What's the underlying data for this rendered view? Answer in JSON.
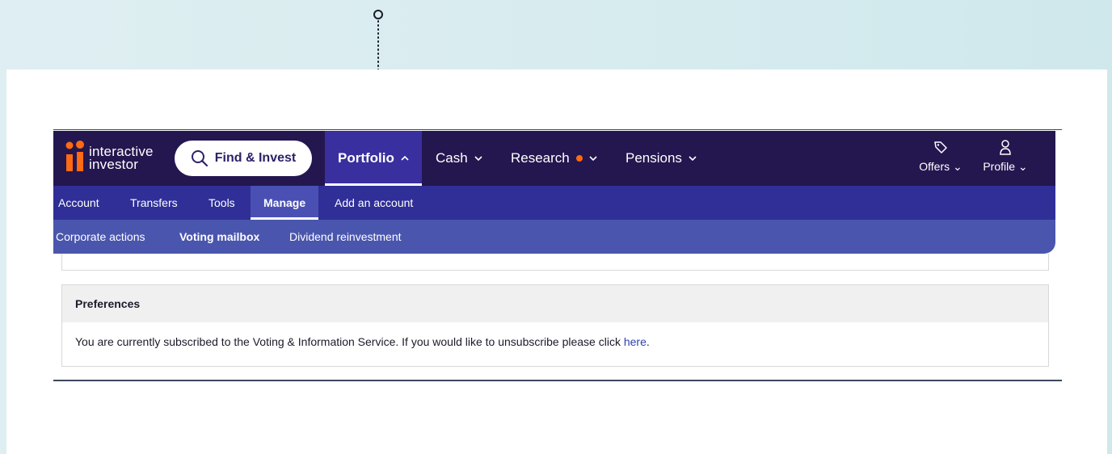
{
  "brand": {
    "line1": "interactive",
    "line2": "investor",
    "orange": "#ff6a13",
    "navy": "#24174f"
  },
  "nav_main": {
    "find_invest": "Find & Invest",
    "items": [
      {
        "label": "Portfolio",
        "chevron": "up"
      },
      {
        "label": "Cash",
        "chevron": "down"
      },
      {
        "label": "Research",
        "chevron": "down",
        "badge": "dot"
      },
      {
        "label": "Pensions",
        "chevron": "down"
      }
    ],
    "utilities": [
      {
        "label": "Offers",
        "icon": "tag-icon"
      },
      {
        "label": "Profile",
        "icon": "user-icon"
      }
    ]
  },
  "nav_sub1": {
    "items": [
      "Account",
      "Transfers",
      "Tools",
      "Manage",
      "Add an account"
    ],
    "active": "Manage"
  },
  "nav_sub2": {
    "items": [
      "Corporate actions",
      "Voting mailbox",
      "Dividend reinvestment"
    ],
    "active": "Voting mailbox"
  },
  "preferences": {
    "title": "Preferences",
    "text": "You are currently subscribed to the Voting & Information Service. If you would like to unsubscribe please click ",
    "link": "here",
    "suffix": "."
  }
}
